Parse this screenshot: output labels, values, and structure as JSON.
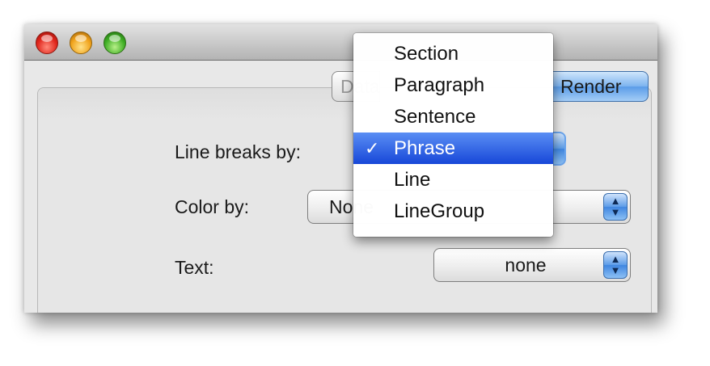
{
  "window": {
    "tabs": [
      {
        "label": "Data"
      },
      {
        "label": "Render"
      }
    ]
  },
  "form": {
    "line_breaks_label": "Line breaks by:",
    "color_by_label": "Color by:",
    "color_by_value": "None",
    "text_label": "Text:",
    "text_value": "none"
  },
  "menu": {
    "check_mark": "✓",
    "items": [
      {
        "label": "Section",
        "selected": false
      },
      {
        "label": "Paragraph",
        "selected": false
      },
      {
        "label": "Sentence",
        "selected": false
      },
      {
        "label": "Phrase",
        "selected": true
      },
      {
        "label": "Line",
        "selected": false
      },
      {
        "label": "LineGroup",
        "selected": false
      }
    ]
  },
  "colors": {
    "selection": "#1f55e0",
    "accent": "#5c9ce8"
  }
}
